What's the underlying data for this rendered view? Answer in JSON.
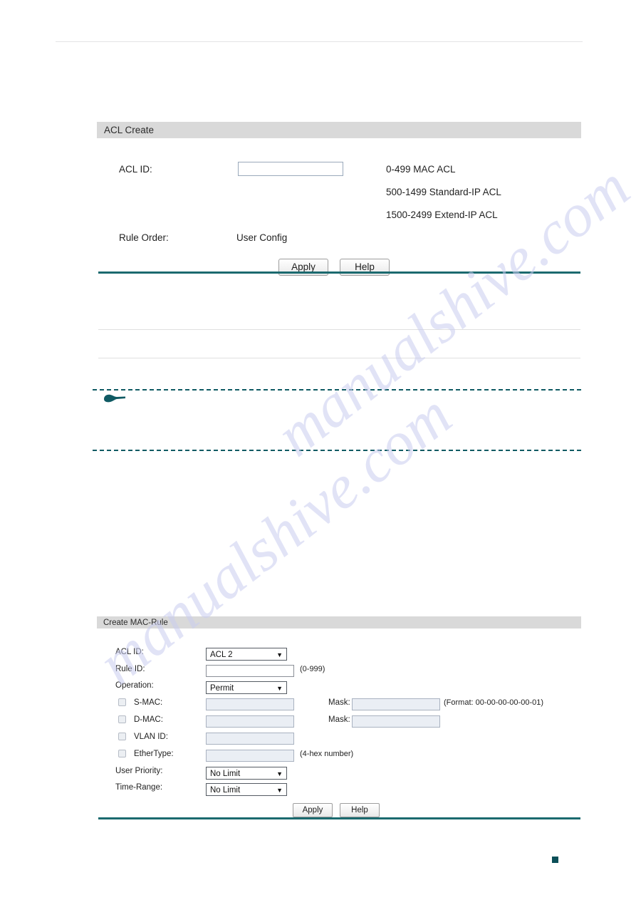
{
  "page": {
    "marker_color": "#0b4f58",
    "accent_color": "#1b6a6f",
    "panel_header_color": "#d9d9d9",
    "watermark_text": "manualshive.com"
  },
  "acl_create": {
    "title": "ACL Create",
    "acl_id_label": "ACL ID:",
    "acl_id_value": "",
    "acl_id_placeholder": "",
    "hints": [
      "0-499 MAC ACL",
      "500-1499 Standard-IP ACL",
      "1500-2499 Extend-IP ACL"
    ],
    "rule_order_label": "Rule Order:",
    "rule_order_value": "User Config",
    "apply_label": "Apply",
    "help_label": "Help"
  },
  "create_mac_rule": {
    "title": "Create MAC-Rule",
    "rows": {
      "acl_id": {
        "label": "ACL ID:",
        "selected": "ACL 2",
        "arrow": "▼"
      },
      "rule_id": {
        "label": "Rule ID:",
        "value": "",
        "hint": "(0-999)"
      },
      "operation": {
        "label": "Operation:",
        "selected": "Permit",
        "arrow": "▼"
      },
      "s_mac": {
        "label": "S-MAC:",
        "value": "",
        "checked": false,
        "mask_label": "Mask:",
        "mask_value": "",
        "hint": "(Format: 00-00-00-00-00-01)"
      },
      "d_mac": {
        "label": "D-MAC:",
        "value": "",
        "checked": false,
        "mask_label": "Mask:",
        "mask_value": ""
      },
      "vlan_id": {
        "label": "VLAN ID:",
        "value": "",
        "checked": false
      },
      "ether_type": {
        "label": "EtherType:",
        "value": "",
        "checked": false,
        "hint": "(4-hex number)"
      },
      "user_priority": {
        "label": "User Priority:",
        "selected": "No Limit",
        "arrow": "▼"
      },
      "time_range": {
        "label": "Time-Range:",
        "selected": "No Limit",
        "arrow": "▼"
      }
    },
    "apply_label": "Apply",
    "help_label": "Help"
  }
}
